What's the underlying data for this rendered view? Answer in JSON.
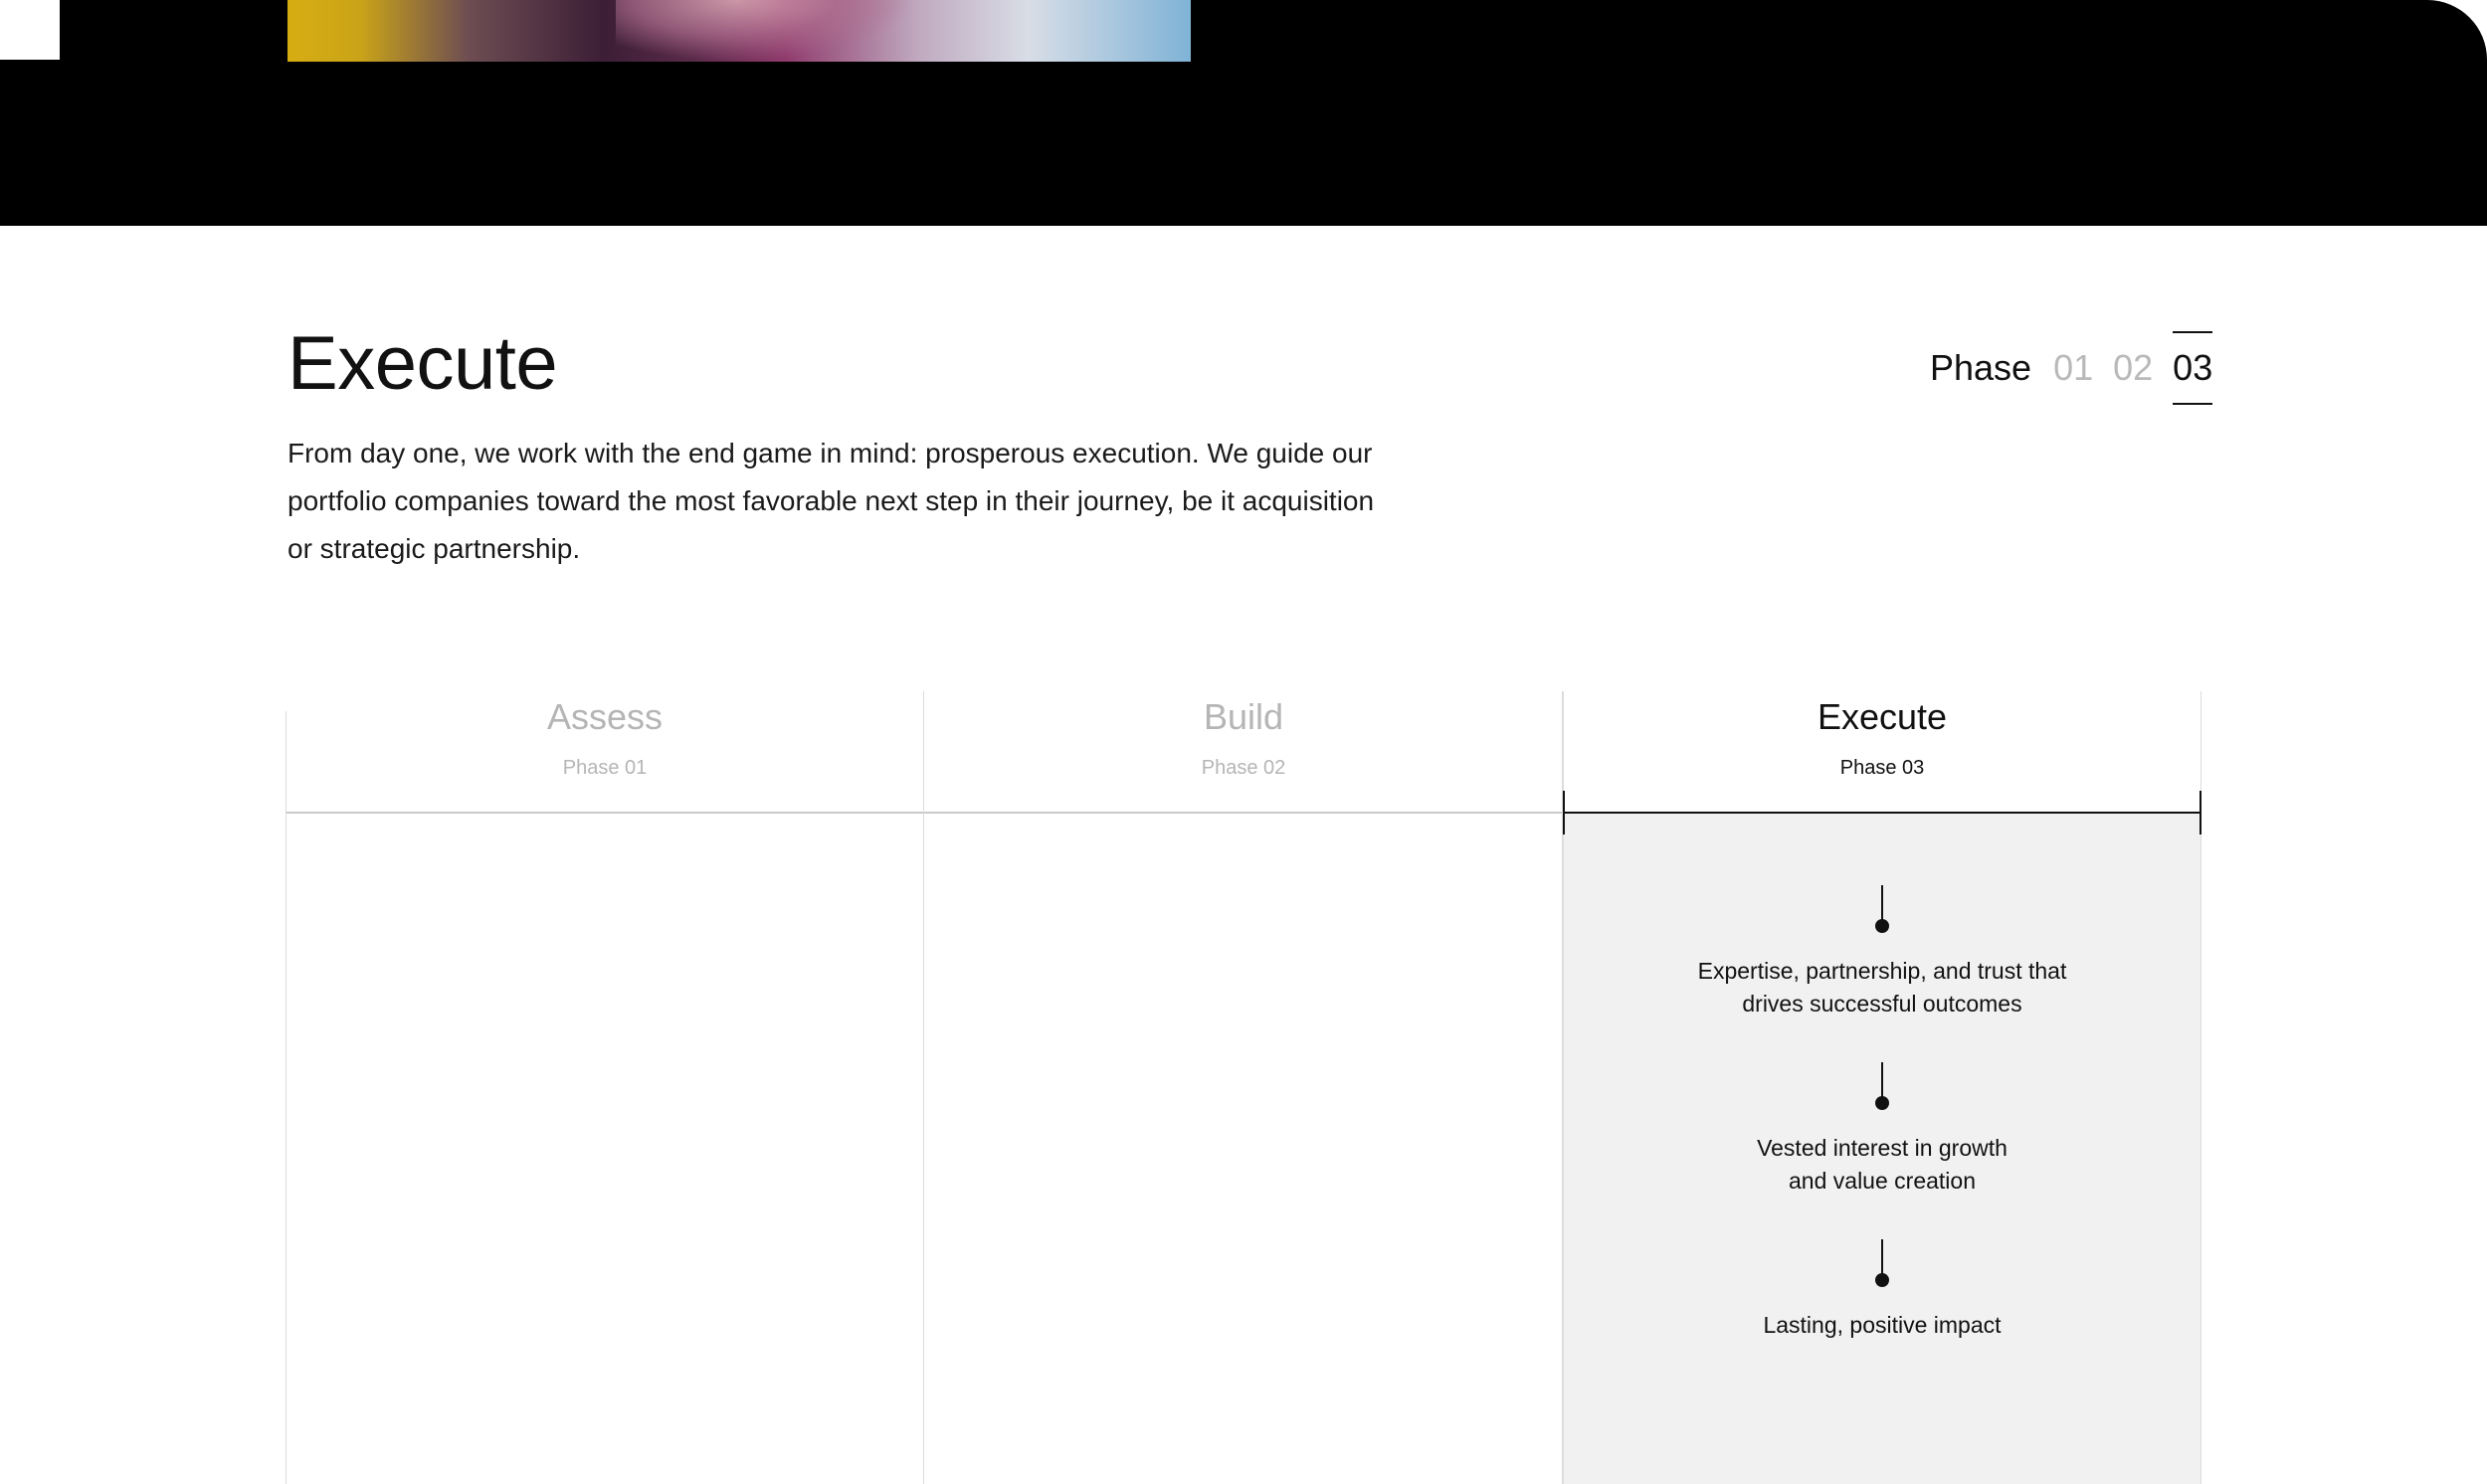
{
  "hero": {
    "image": "team-meeting-photo"
  },
  "section": {
    "title": "Execute",
    "description": "From day one, we work with the end game in mind: prosperous execution. We guide our portfolio companies toward the most favorable next step in their journey, be it acquisition or strategic partnership."
  },
  "phase_indicator": {
    "label": "Phase",
    "numbers": [
      "01",
      "02",
      "03"
    ],
    "active_index": 2
  },
  "phases": [
    {
      "title": "Assess",
      "subtitle": "Phase 01"
    },
    {
      "title": "Build",
      "subtitle": "Phase 02"
    },
    {
      "title": "Execute",
      "subtitle": "Phase 03"
    }
  ],
  "active_points": [
    {
      "line1": "Expertise, partnership, and trust that",
      "line2": "drives successful outcomes"
    },
    {
      "line1": "Vested interest in growth",
      "line2": "and value creation"
    },
    {
      "line1": "Lasting, positive impact",
      "line2": ""
    }
  ],
  "colors": {
    "active_text": "#111111",
    "inactive_text": "#b5b5b5",
    "active_panel": "#f1f1f1",
    "hero_band": "#000000"
  }
}
